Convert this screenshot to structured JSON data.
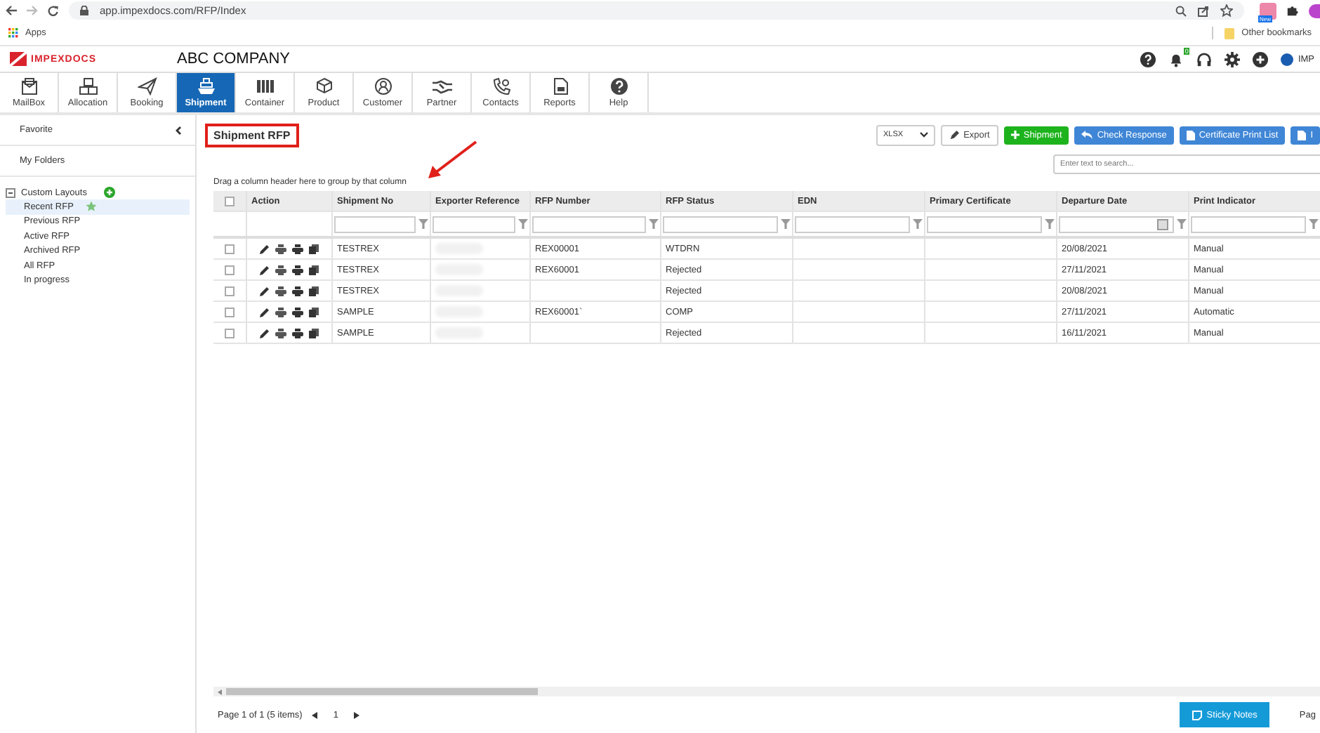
{
  "browser": {
    "url": "app.impexdocs.com/RFP/Index",
    "bookmarks": [
      {
        "label": "Apps"
      },
      {
        "label": "Other bookmarks"
      }
    ],
    "profile_badge": "New"
  },
  "app_header": {
    "logo": "IMPEXDOCS",
    "company": "ABC COMPANY",
    "notification_count": "0",
    "user": "IMP"
  },
  "nav": [
    {
      "label": "MailBox",
      "selected": false
    },
    {
      "label": "Allocation",
      "selected": false
    },
    {
      "label": "Booking",
      "selected": false
    },
    {
      "label": "Shipment",
      "selected": true
    },
    {
      "label": "Container",
      "selected": false
    },
    {
      "label": "Product",
      "selected": false
    },
    {
      "label": "Customer",
      "selected": false
    },
    {
      "label": "Partner",
      "selected": false
    },
    {
      "label": "Contacts",
      "selected": false
    },
    {
      "label": "Reports",
      "selected": false
    },
    {
      "label": "Help",
      "selected": false
    }
  ],
  "sidebar": {
    "favorite": "Favorite",
    "my_folders": "My Folders",
    "custom_layouts": {
      "label": "Custom Layouts",
      "expanded": true,
      "items": [
        {
          "label": "Recent RFP",
          "selected": true,
          "starred": true
        },
        {
          "label": "Previous RFP",
          "selected": false,
          "starred": false
        },
        {
          "label": "Active RFP",
          "selected": false,
          "starred": false
        },
        {
          "label": "Archived RFP",
          "selected": false,
          "starred": false
        },
        {
          "label": "All RFP",
          "selected": false,
          "starred": false
        },
        {
          "label": "In progress",
          "selected": false,
          "starred": false
        }
      ]
    }
  },
  "page_title": {
    "text": "Shipment RFP",
    "highlighted": true
  },
  "annotation_arrow": true,
  "toolbar": {
    "format": "XLSX",
    "buttons": [
      {
        "label": "Export",
        "kind": "plain"
      },
      {
        "label": "Shipment",
        "kind": "add"
      },
      {
        "label": "Check Response",
        "kind": "reply"
      },
      {
        "label": "Certificate Print List",
        "kind": "doc"
      },
      {
        "label": "I",
        "kind": "doc"
      }
    ],
    "search_placeholder": "Enter text to search..."
  },
  "group_hint": "Drag a column header here to group by that column",
  "table": {
    "select_all_checked": false,
    "columns": [
      {
        "label": "Action",
        "filter": false
      },
      {
        "label": "Shipment No",
        "filter": true
      },
      {
        "label": "Exporter Reference",
        "filter": true
      },
      {
        "label": "RFP Number",
        "filter": true
      },
      {
        "label": "RFP Status",
        "filter": true
      },
      {
        "label": "EDN",
        "filter": true
      },
      {
        "label": "Primary Certificate",
        "filter": true
      },
      {
        "label": "Departure Date",
        "filter": true,
        "kind": "date"
      },
      {
        "label": "Print Indicator",
        "filter": true
      }
    ],
    "rows": [
      {
        "checked": false,
        "shipment_no": "TESTREX",
        "exporter_reference_redacted": true,
        "rfp_number": "REX00001",
        "rfp_status": "WTDRN",
        "edn": "",
        "primary_certificate": "",
        "departure_date": "20/08/2021",
        "print_indicator": "Manual"
      },
      {
        "checked": false,
        "shipment_no": "TESTREX",
        "exporter_reference_redacted": true,
        "rfp_number": "REX60001",
        "rfp_status": "Rejected",
        "edn": "",
        "primary_certificate": "",
        "departure_date": "27/11/2021",
        "print_indicator": "Manual"
      },
      {
        "checked": false,
        "shipment_no": "TESTREX",
        "exporter_reference_redacted": true,
        "rfp_number": "",
        "rfp_status": "Rejected",
        "edn": "",
        "primary_certificate": "",
        "departure_date": "20/08/2021",
        "print_indicator": "Manual"
      },
      {
        "checked": false,
        "shipment_no": "SAMPLE",
        "exporter_reference_redacted": true,
        "rfp_number": "REX60001`",
        "rfp_status": "COMP",
        "edn": "",
        "primary_certificate": "",
        "departure_date": "27/11/2021",
        "print_indicator": "Automatic"
      },
      {
        "checked": false,
        "shipment_no": "SAMPLE",
        "exporter_reference_redacted": true,
        "rfp_number": "",
        "rfp_status": "Rejected",
        "edn": "",
        "primary_certificate": "",
        "departure_date": "16/11/2021",
        "print_indicator": "Manual"
      }
    ]
  },
  "pager": {
    "summary": "Page 1 of 1 (5 items)",
    "current": "1",
    "right_text": "Pag"
  },
  "sticky_notes": "Sticky Notes"
}
